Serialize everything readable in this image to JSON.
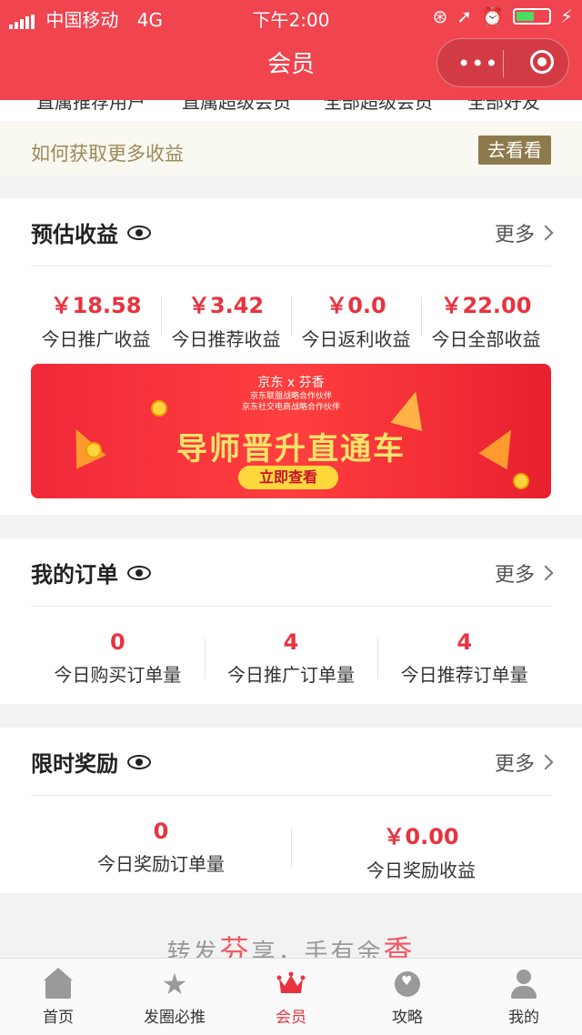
{
  "status": {
    "carrier": "中国移动",
    "network": "4G",
    "time": "下午2:00"
  },
  "nav": {
    "title": "会员"
  },
  "partial_row": [
    "直属推荐用户",
    "直属超级会员",
    "全部超级会员",
    "全部好友"
  ],
  "how": {
    "text": "如何获取更多收益",
    "button": "去看看"
  },
  "estimated": {
    "title": "预估收益",
    "more": "更多",
    "items": [
      {
        "value": "￥18.58",
        "label": "今日推广收益"
      },
      {
        "value": "￥3.42",
        "label": "今日推荐收益"
      },
      {
        "value": "￥0.0",
        "label": "今日返利收益"
      },
      {
        "value": "￥22.00",
        "label": "今日全部收益"
      }
    ]
  },
  "banner": {
    "logo": "京东 x 芬香",
    "sub1": "京东联盟战略合作伙伴",
    "sub2": "京东社交电商战略合作伙伴",
    "headline": "导师晋升直通车",
    "cta": "立即查看"
  },
  "orders": {
    "title": "我的订单",
    "more": "更多",
    "items": [
      {
        "value": "0",
        "label": "今日购买订单量"
      },
      {
        "value": "4",
        "label": "今日推广订单量"
      },
      {
        "value": "4",
        "label": "今日推荐订单量"
      }
    ]
  },
  "reward": {
    "title": "限时奖励",
    "more": "更多",
    "items": [
      {
        "value": "0",
        "label": "今日奖励订单量"
      },
      {
        "value": "￥0.00",
        "label": "今日奖励收益"
      }
    ]
  },
  "slogan": {
    "p1": "转发",
    "p2": "芬",
    "p3": "享，手有余",
    "p4": "香"
  },
  "tabs": [
    {
      "label": "首页",
      "icon": "home-icon"
    },
    {
      "label": "发圈必推",
      "icon": "star-icon"
    },
    {
      "label": "会员",
      "icon": "crown-icon"
    },
    {
      "label": "攻略",
      "icon": "heart-circle-icon"
    },
    {
      "label": "我的",
      "icon": "person-icon"
    }
  ],
  "colors": {
    "brand": "#f0444e",
    "accent": "#e8333f",
    "gold": "#8d7a4c"
  }
}
